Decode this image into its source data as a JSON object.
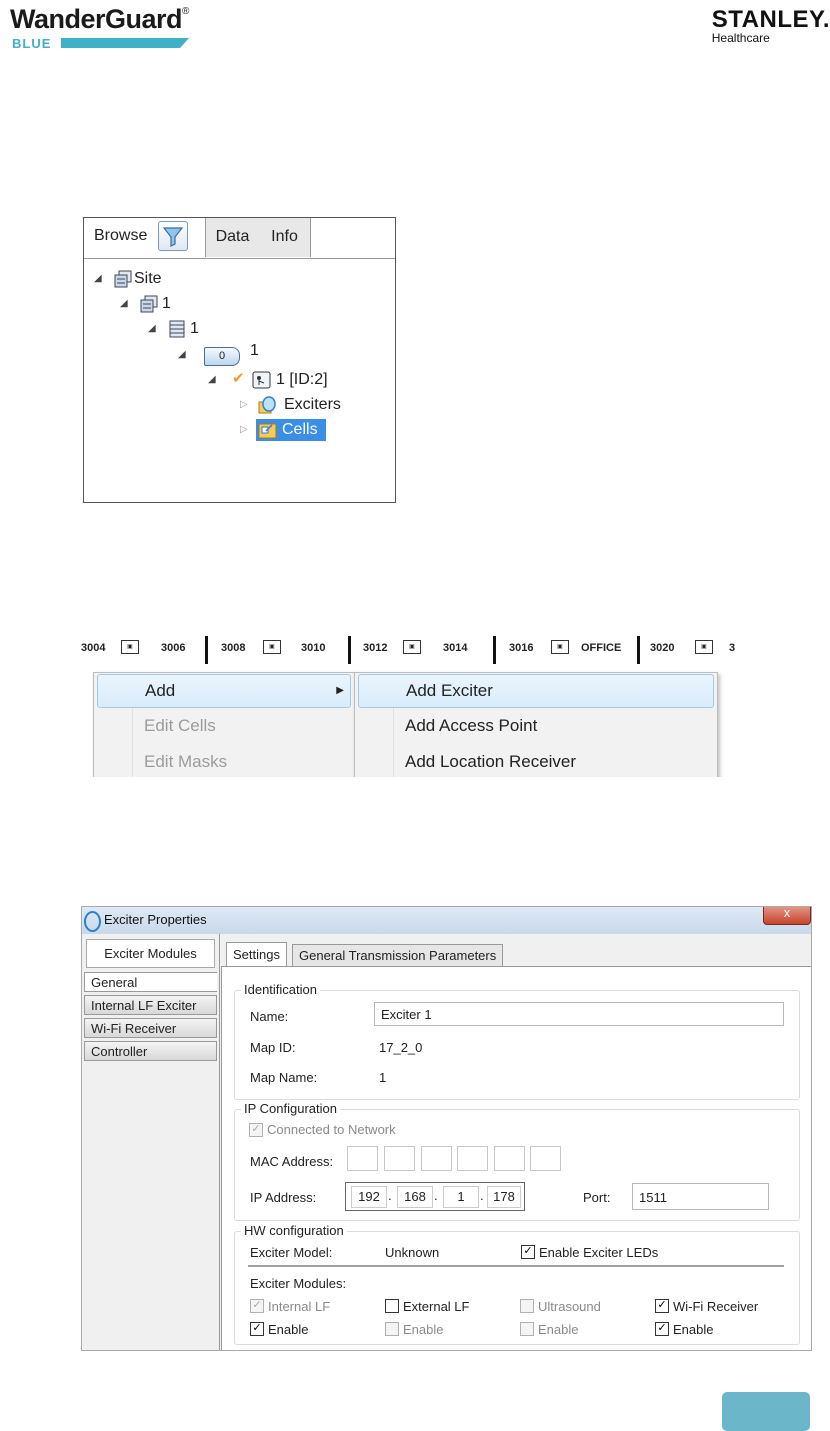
{
  "header": {
    "wg_brand": "WanderGuard",
    "wg_reg": "®",
    "wg_sub": "BLUE",
    "stanley_brand": "STANLEY.",
    "stanley_sub": "Healthcare"
  },
  "browse": {
    "tabs": {
      "browse": "Browse",
      "data": "Data",
      "info": "Info"
    },
    "tree": {
      "site": "Site",
      "building": "1",
      "floor": "1",
      "zero_badge": "0",
      "zone": "1",
      "controller": "1 [ID:2]",
      "exciters": "Exciters",
      "cells": "Cells"
    }
  },
  "floorplan": {
    "rooms": [
      "3004",
      "3006",
      "3008",
      "3010",
      "3012",
      "3014",
      "3016",
      "OFFICE",
      "3020",
      "3"
    ]
  },
  "context_menu": {
    "main": {
      "add": "Add",
      "edit_cells": "Edit Cells",
      "edit_masks": "Edit Masks"
    },
    "sub": {
      "add_exciter": "Add Exciter",
      "add_access_point": "Add Access Point",
      "add_location_receiver": "Add Location Receiver"
    }
  },
  "dialog": {
    "title": "Exciter Properties",
    "close": "x",
    "left_tabs": {
      "exciter_modules": "Exciter Modules",
      "items": [
        "General",
        "Internal LF Exciter",
        "Wi-Fi Receiver",
        "Controller"
      ]
    },
    "tabs": {
      "settings": "Settings",
      "general_tx": "General Transmission Parameters"
    },
    "identification": {
      "title": "Identification",
      "name_label": "Name:",
      "name_value": "Exciter 1",
      "map_id_label": "Map ID:",
      "map_id_value": "17_2_0",
      "map_name_label": "Map Name:",
      "map_name_value": "1"
    },
    "ip_config": {
      "title": "IP Configuration",
      "connected_label": "Connected to Network",
      "mac_label": "MAC Address:",
      "ip_label": "IP Address:",
      "ip": [
        "192",
        "168",
        "1",
        "178"
      ],
      "port_label": "Port:",
      "port_value": "1511"
    },
    "hw_config": {
      "title": "HW configuration",
      "model_label": "Exciter Model:",
      "model_value": "Unknown",
      "enable_leds": "Enable Exciter LEDs",
      "modules_label": "Exciter Modules:",
      "internal_lf": "Internal LF",
      "external_lf": "External LF",
      "ultrasound": "Ultrasound",
      "wifi_receiver": "Wi-Fi Receiver",
      "enable": "Enable"
    },
    "checkmark": "✓"
  },
  "colors": {
    "accent": "#3fb0c8",
    "selection": "#3a8ee6",
    "button": "#6bb7c9"
  }
}
